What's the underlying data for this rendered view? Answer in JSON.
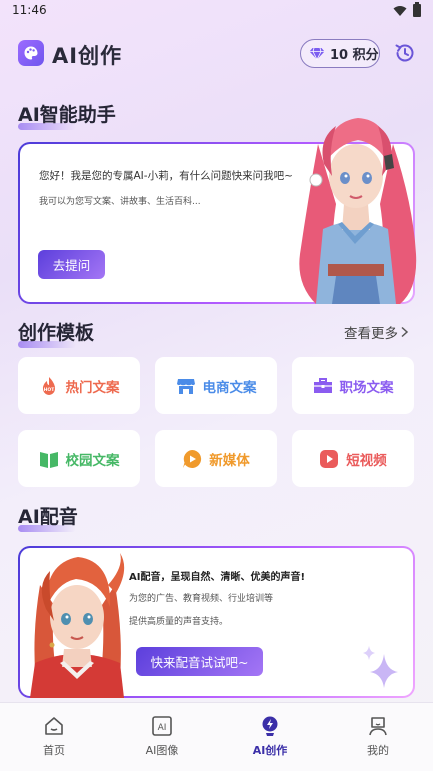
{
  "status_bar": {
    "time": "11:46"
  },
  "header": {
    "title": "AI创作",
    "points": "10 积分"
  },
  "assistant": {
    "section_title": "AI智能助手",
    "greeting": "您好！我是您的专属AI-小莉，有什么问题快来问我吧~",
    "subtitle": "我可以为您写文案、讲故事、生活百科...",
    "ask_button": "去提问"
  },
  "templates": {
    "section_title": "创作模板",
    "view_more": "查看更多",
    "items": [
      {
        "label": "热门文案",
        "color": "#ee6a4f",
        "icon": "hot-icon"
      },
      {
        "label": "电商文案",
        "color": "#4b8ce8",
        "icon": "shop-icon"
      },
      {
        "label": "职场文案",
        "color": "#8b5cf0",
        "icon": "briefcase-icon"
      },
      {
        "label": "校园文案",
        "color": "#46b866",
        "icon": "book-icon"
      },
      {
        "label": "新媒体",
        "color": "#f09a2c",
        "icon": "play-bubble-icon"
      },
      {
        "label": "短视频",
        "color": "#ea5b5b",
        "icon": "video-icon"
      }
    ]
  },
  "voice": {
    "section_title": "AI配音",
    "headline": "AI配音，呈现自然、清晰、优美的声音!",
    "line1": "为您的广告、教育视频、行业培训等",
    "line2": "提供高质量的声音支持。",
    "button": "快来配音试试吧~"
  },
  "tabs": [
    {
      "label": "首页",
      "icon": "home-icon",
      "active": false
    },
    {
      "label": "AI图像",
      "icon": "ai-image-icon",
      "active": false
    },
    {
      "label": "AI创作",
      "icon": "ai-create-icon",
      "active": true
    },
    {
      "label": "我的",
      "icon": "profile-icon",
      "active": false
    }
  ],
  "colors": {
    "accent": "#5c3fdc",
    "accent_light": "#a476f5",
    "active_tab": "#3b2fa8"
  }
}
